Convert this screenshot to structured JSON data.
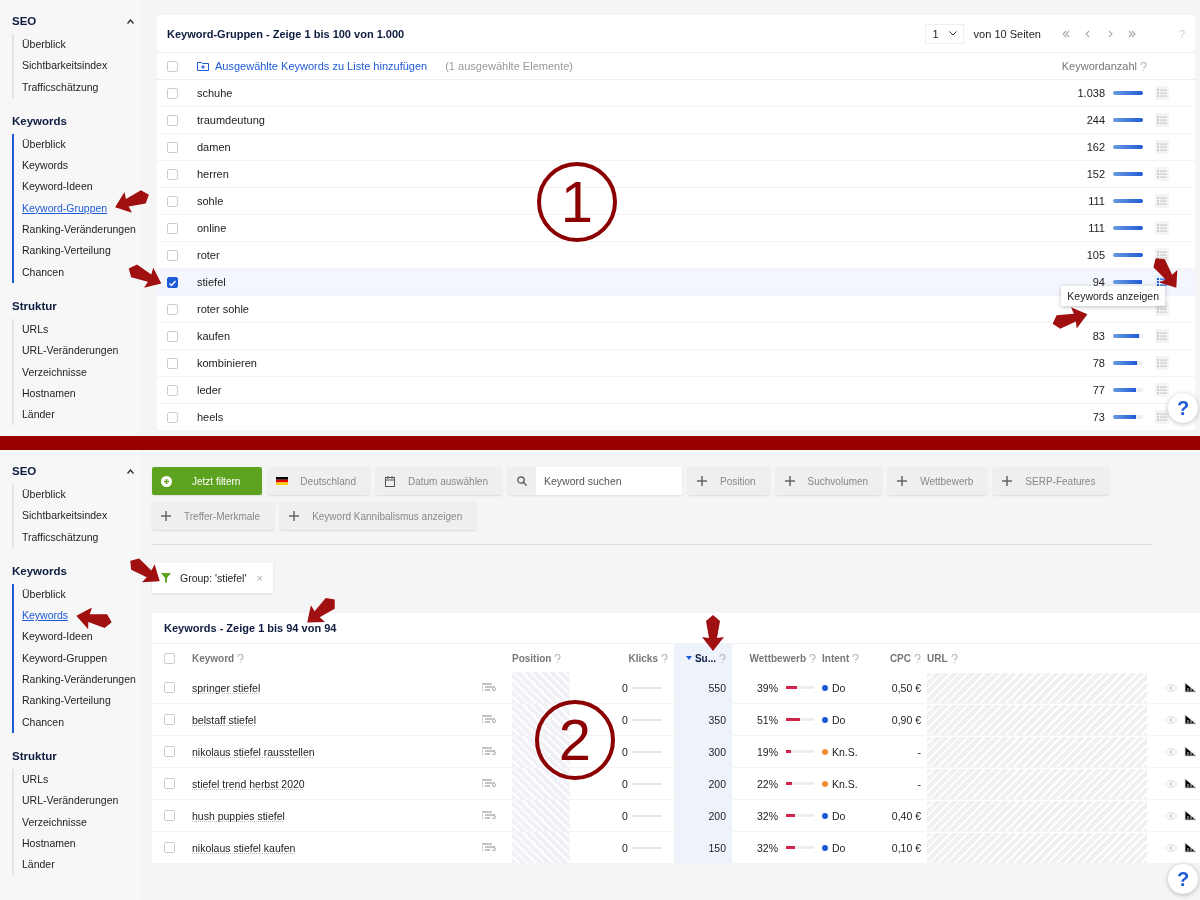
{
  "top_view": {
    "sidebar": [
      {
        "title": "SEO",
        "expanded": true,
        "active": false,
        "items": [
          {
            "label": "Überblick",
            "selected": false
          },
          {
            "label": "Sichtbarkeitsindex",
            "selected": false
          },
          {
            "label": "Trafficschätzung",
            "selected": false
          }
        ]
      },
      {
        "title": "Keywords",
        "active": true,
        "items": [
          {
            "label": "Überblick",
            "selected": false
          },
          {
            "label": "Keywords",
            "selected": false
          },
          {
            "label": "Keyword-Ideen",
            "selected": false
          },
          {
            "label": "Keyword-Gruppen",
            "selected": true
          },
          {
            "label": "Ranking-Veränderungen",
            "selected": false
          },
          {
            "label": "Ranking-Verteilung",
            "selected": false
          },
          {
            "label": "Chancen",
            "selected": false
          }
        ]
      },
      {
        "title": "Struktur",
        "active": false,
        "items": [
          {
            "label": "URLs",
            "selected": false
          },
          {
            "label": "URL-Veränderungen",
            "selected": false
          },
          {
            "label": "Verzeichnisse",
            "selected": false
          },
          {
            "label": "Hostnamen",
            "selected": false
          },
          {
            "label": "Länder",
            "selected": false
          }
        ]
      }
    ],
    "table": {
      "title": "Keyword-Gruppen - Zeige 1 bis 100 von 1.000",
      "all_checked": false,
      "page": "1",
      "page_total": "von 10 Seiten",
      "help": "?",
      "action": "Ausgewählte Keywords zu Liste hinzufügen",
      "selection_count": "(1 ausgewählte Elemente)",
      "count_column": "Keywordanzahl",
      "rows": [
        {
          "name": "schuhe",
          "count": "1.038",
          "level": 1,
          "checked": false,
          "hovered": false
        },
        {
          "name": "traumdeutung",
          "count": "244",
          "level": 1,
          "checked": false,
          "hovered": false
        },
        {
          "name": "damen",
          "count": "162",
          "level": 1,
          "checked": false,
          "hovered": false
        },
        {
          "name": "herren",
          "count": "152",
          "level": 1,
          "checked": false,
          "hovered": false
        },
        {
          "name": "sohle",
          "count": "111",
          "level": 1,
          "checked": false,
          "hovered": false
        },
        {
          "name": "online",
          "count": "111",
          "level": 1,
          "checked": false,
          "hovered": false
        },
        {
          "name": "roter",
          "count": "105",
          "level": 1,
          "checked": false,
          "hovered": false
        },
        {
          "name": "stiefel",
          "count": "94",
          "level": 0.95,
          "checked": true,
          "hovered": true,
          "tooltip": "Keywords anzeigen"
        },
        {
          "name": "roter sohle",
          "checked": false,
          "hovered": false
        },
        {
          "name": "kaufen",
          "count": "83",
          "level": 0.85,
          "checked": false,
          "hovered": false
        },
        {
          "name": "kombinieren",
          "count": "78",
          "level": 0.8,
          "checked": false,
          "hovered": false
        },
        {
          "name": "leder",
          "count": "77",
          "level": 0.78,
          "checked": false,
          "hovered": false
        },
        {
          "name": "heels",
          "count": "73",
          "level": 0.75,
          "checked": false,
          "hovered": false
        }
      ]
    },
    "marker": "1",
    "help_button": "?"
  },
  "bottom_view": {
    "sidebar": [
      {
        "title": "SEO",
        "expanded": true,
        "active": false,
        "items": [
          {
            "label": "Überblick",
            "selected": false
          },
          {
            "label": "Sichtbarkeitsindex",
            "selected": false
          },
          {
            "label": "Trafficschätzung",
            "selected": false
          }
        ]
      },
      {
        "title": "Keywords",
        "active": true,
        "items": [
          {
            "label": "Überblick",
            "selected": false
          },
          {
            "label": "Keywords",
            "selected": true
          },
          {
            "label": "Keyword-Ideen",
            "selected": false
          },
          {
            "label": "Keyword-Gruppen",
            "selected": false
          },
          {
            "label": "Ranking-Veränderungen",
            "selected": false
          },
          {
            "label": "Ranking-Verteilung",
            "selected": false
          },
          {
            "label": "Chancen",
            "selected": false
          }
        ]
      },
      {
        "title": "Struktur",
        "active": false,
        "items": [
          {
            "label": "URLs",
            "selected": false
          },
          {
            "label": "URL-Veränderungen",
            "selected": false
          },
          {
            "label": "Verzeichnisse",
            "selected": false
          },
          {
            "label": "Hostnamen",
            "selected": false
          },
          {
            "label": "Länder",
            "selected": false
          }
        ]
      }
    ],
    "filters": [
      {
        "kind": "primary",
        "label": "Jetzt filtern"
      },
      {
        "kind": "country",
        "label": "Deutschland"
      },
      {
        "kind": "date",
        "label": "Datum auswählen"
      },
      {
        "kind": "search",
        "placeholder": "Keyword suchen"
      },
      {
        "kind": "add",
        "label": "Position"
      },
      {
        "kind": "add",
        "label": "Suchvolumen"
      },
      {
        "kind": "add",
        "label": "Wettbewerb"
      },
      {
        "kind": "add",
        "label": "SERP-Features"
      },
      {
        "kind": "add",
        "label": "Treffer-Merkmale"
      },
      {
        "kind": "add",
        "label": "Keyword Kannibalismus anzeigen"
      }
    ],
    "active_filter": {
      "label": "Group: 'stiefel'",
      "close": "×"
    },
    "table": {
      "title": "Keywords - Zeige 1 bis 94 von 94",
      "all_checked": false,
      "columns": [
        {
          "label": "Keyword",
          "sorted": false
        },
        {
          "label": "Position",
          "sorted": false
        },
        {
          "label": "Klicks",
          "sorted": false
        },
        {
          "label": "Su...",
          "sorted": true
        },
        {
          "label": "Wettbewerb",
          "sorted": false
        },
        {
          "label": "Intent",
          "sorted": false
        },
        {
          "label": "CPC",
          "sorted": false
        },
        {
          "label": "URL",
          "sorted": false
        }
      ],
      "rows": [
        {
          "keyword": "springer stiefel",
          "serp_count": "6",
          "clicks": "0",
          "volume": "550",
          "competition": "39%",
          "level": 0.39,
          "intent": "Do",
          "color": "#1f5bd6",
          "cpc": "0,50 €",
          "checked": false
        },
        {
          "keyword": "belstaff stiefel",
          "serp_count": "6",
          "clicks": "0",
          "volume": "350",
          "competition": "51%",
          "level": 0.51,
          "intent": "Do",
          "color": "#1f5bd6",
          "cpc": "0,90 €",
          "checked": false
        },
        {
          "keyword": "nikolaus stiefel rausstellen",
          "serp_count": "5",
          "clicks": "0",
          "volume": "300",
          "competition": "19%",
          "level": 0.19,
          "intent": "Kn.S.",
          "color": "#f28a2e",
          "cpc": "-",
          "checked": false
        },
        {
          "keyword": "stiefel trend herbst 2020",
          "serp_count": "6",
          "clicks": "0",
          "volume": "200",
          "competition": "22%",
          "level": 0.22,
          "intent": "Kn.S.",
          "color": "#f28a2e",
          "cpc": "-",
          "checked": false
        },
        {
          "keyword": "hush puppies stiefel",
          "serp_count": "5",
          "clicks": "0",
          "volume": "200",
          "competition": "32%",
          "level": 0.32,
          "intent": "Do",
          "color": "#1f5bd6",
          "cpc": "0,40 €",
          "checked": false
        },
        {
          "keyword": "nikolaus stiefel kaufen",
          "serp_count": "5",
          "clicks": "0",
          "volume": "150",
          "competition": "32%",
          "level": 0.32,
          "intent": "Do",
          "color": "#1f5bd6",
          "cpc": "0,10 €",
          "checked": false
        }
      ]
    },
    "marker": "2",
    "help_button": "?"
  }
}
